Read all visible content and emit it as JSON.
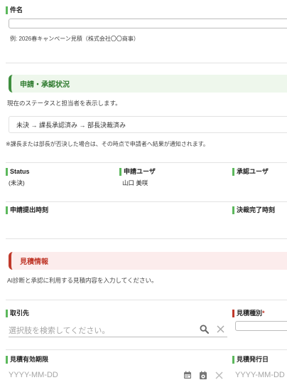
{
  "subject": {
    "label": "件名",
    "value": "",
    "example": "例: 2026春キャンペーン見積（株式会社〇〇商事）"
  },
  "approval_section": {
    "title": "申請・承認状況",
    "description": "現在のステータスと担当者を表示します。",
    "flow": "未決 → 課長承認済み → 部長決裁済み",
    "note": "※課長または部長が否決した場合は、その時点で申請者へ結果が通知されます。",
    "status_label": "Status",
    "status_value": "(未決)",
    "applicant_label": "申請ユーザ",
    "applicant_value": "山口 美咲",
    "approver_label": "承認ユーザ",
    "approver_value": "",
    "submitted_label": "申請提出時刻",
    "submitted_value": "",
    "completed_label": "決裁完了時刻",
    "completed_value": ""
  },
  "estimate_section": {
    "title": "見積情報",
    "description": "AI診断と承認に利用する見積内容を入力してください。",
    "client_label": "取引先",
    "client_placeholder": "選択肢を検索してください。",
    "type_label": "見積種別",
    "type_required": "*",
    "validity_label": "見積有効期限",
    "validity_placeholder": "YYYY-MM-DD",
    "issue_label": "見積発行日",
    "issue_placeholder": "YYYY-MM-DD"
  },
  "colors": {
    "accent_green": "#5cb85c",
    "accent_red": "#c0392b",
    "icon_gray": "#777777"
  },
  "icons": {
    "search": "search-icon",
    "clear": "clear-icon",
    "calendar": "calendar-icon",
    "calendar_today": "calendar-today-icon"
  }
}
